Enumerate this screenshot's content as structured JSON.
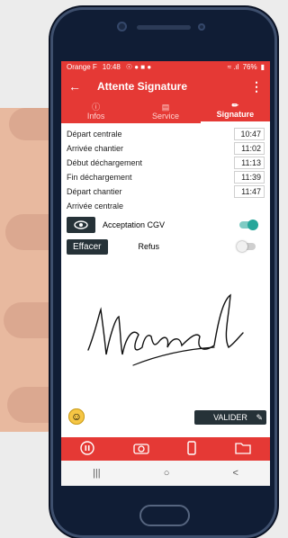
{
  "statusbar": {
    "carrier": "Orange F",
    "time": "10:48",
    "notif_icons": "☉ ● ■ ●",
    "signal": "≈ .ıl",
    "battery": "76%"
  },
  "appbar": {
    "back_icon": "arrow-back-icon",
    "title": "Attente Signature",
    "menu_icon": "more-vert-icon"
  },
  "tabs": [
    {
      "label": "Infos",
      "icon": "info-icon"
    },
    {
      "label": "Service",
      "icon": "document-icon"
    },
    {
      "label": "Signature",
      "icon": "pen-icon",
      "active": true
    }
  ],
  "times": [
    {
      "label": "Départ centrale",
      "value": "10:47"
    },
    {
      "label": "Arrivée chantier",
      "value": "11:02"
    },
    {
      "label": "Début déchargement",
      "value": "11:13"
    },
    {
      "label": "Fin déchargement",
      "value": "11:39"
    },
    {
      "label": "Départ chantier",
      "value": "11:47"
    },
    {
      "label": "Arrivée centrale",
      "value": ""
    }
  ],
  "cgv": {
    "label": "Acceptation CGV",
    "checked": true
  },
  "effacer_label": "Effacer",
  "refus": {
    "label": "Refus",
    "checked": false
  },
  "signature_text": "Marcel",
  "valider_label": "VALIDER",
  "bottom_nav": [
    "pause-icon",
    "camera-icon",
    "phone-icon",
    "folder-icon"
  ],
  "system_nav": [
    "|||",
    "○",
    "<"
  ],
  "colors": {
    "accent": "#e53935",
    "dark_button": "#263238",
    "toggle_on": "#26a69a"
  }
}
